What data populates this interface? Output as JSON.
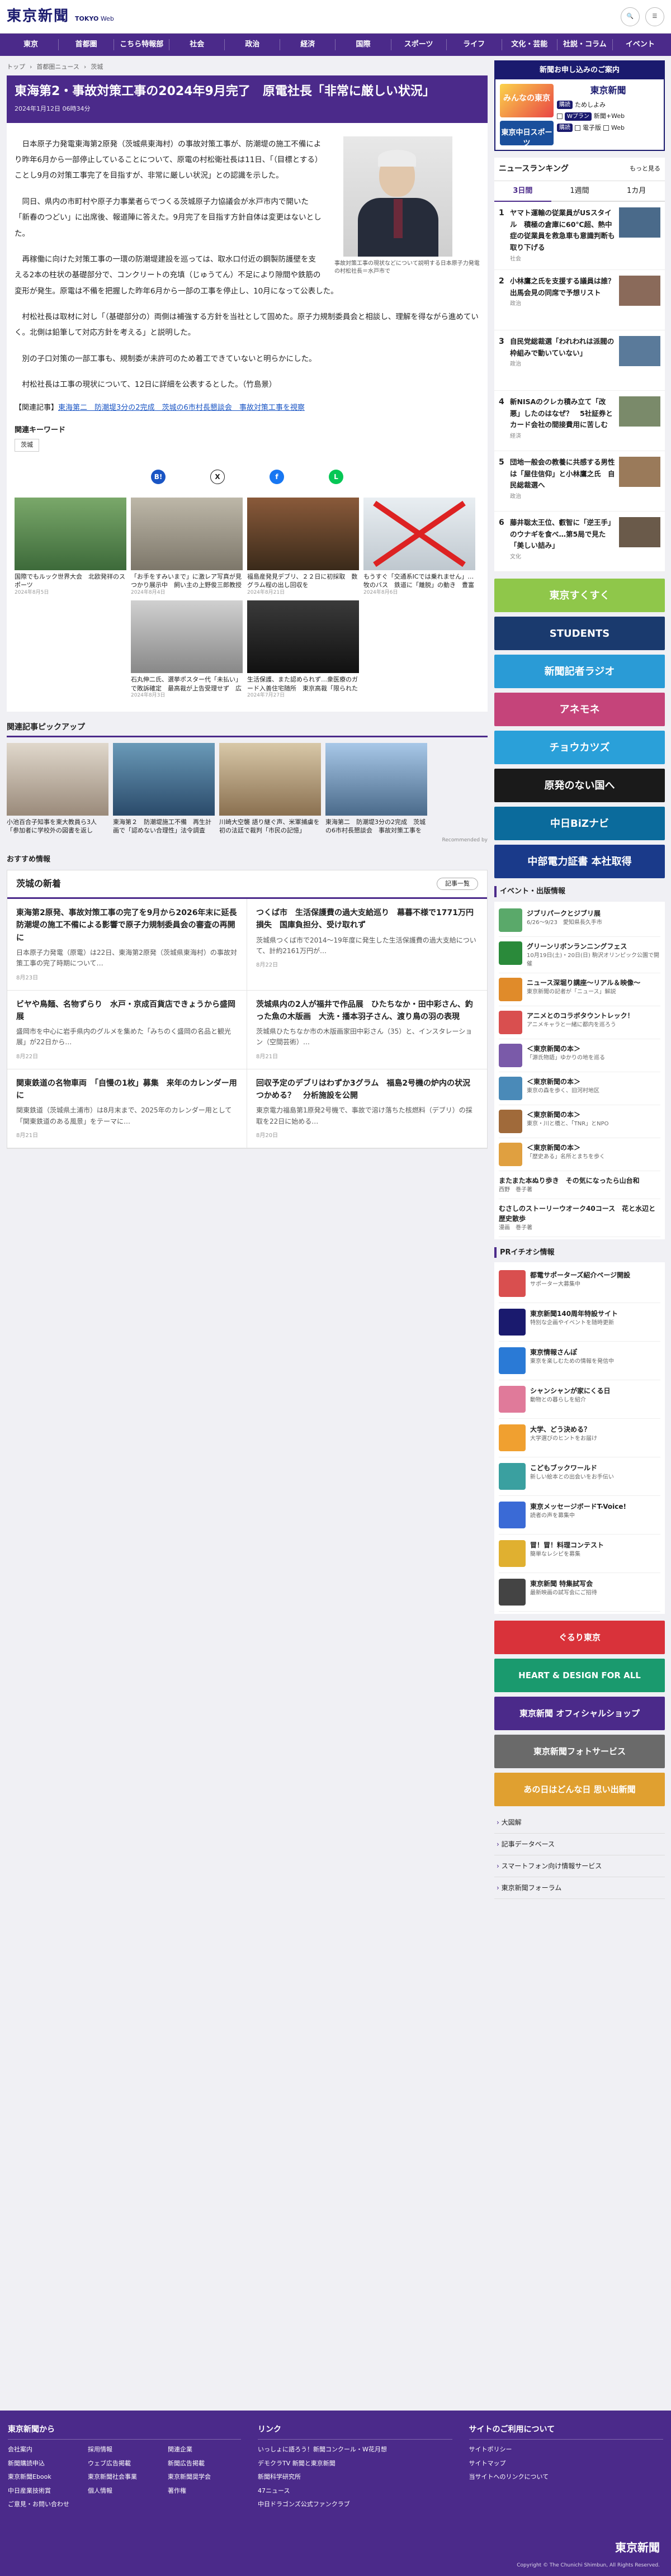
{
  "header": {
    "logo": "東京新聞",
    "edition_a": "TOKYO",
    "edition_b": "Web",
    "search": "検索",
    "menu": "メニュー"
  },
  "nav": [
    "東京",
    "首都圏",
    "こちら特報部",
    "社会",
    "政治",
    "経済",
    "国際",
    "スポーツ",
    "ライフ",
    "文化・芸能",
    "社説・コラム",
    "イベント"
  ],
  "crumb": [
    "トップ",
    "首都圏ニュース",
    "茨城"
  ],
  "article": {
    "title": "東海第2・事故対策工事の2024年9月完了　原電社長「非常に厳しい状況」",
    "date": "2024年1月12日 06時34分",
    "caption": "事故対策工事の現状などについて説明する日本原子力発電の村松社長＝水戸市で",
    "paras": [
      "日本原子力発電東海第2原発（茨城県東海村）の事故対策工事が、防潮堤の施工不備により昨年6月から一部停止していることについて、原電の村松衛社長は11日、「（目標とする）ことし9月の対策工事完了を目指すが、非常に厳しい状況」との認識を示した。",
      "同日、県内の市町村や原子力事業者らでつくる茨城原子力協議会が水戸市内で開いた「新春のつどい」に出席後、報道陣に答えた。9月完了を目指す方針自体は変更はないとした。",
      "再稼働に向けた対策工事の一環の防潮堤建設を巡っては、取水口付近の鋼製防護壁を支える2本の柱状の基礎部分で、コンクリートの充填（じゅうてん）不足により隙間や鉄筋の変形が発生。原電は不備を把握した昨年6月から一部の工事を停止し、10月になって公表した。",
      "村松社長は取材に対し「（基礎部分の）両側は補強する方針を当社として固めた。原子力規制委員会と相談し、理解を得ながら進めていく。北側は鉛筆して対応方針を考える」と説明した。",
      "別の子口対策の一部工事も、規制委が未許可のため着工できていないと明らかにした。",
      "村松社長は工事の現状について、12日に詳細を公表するとした。（竹島景）"
    ],
    "related_label": "【関連記事】",
    "related_link": "東海第二　防潮堤3分の2完成　茨城の6市村長懇談会　事故対策工事を視察"
  },
  "keywords": {
    "title": "関連キーワード",
    "tag": "茨城"
  },
  "share": [
    "B!",
    "X",
    "f",
    "L"
  ],
  "grid": [
    {
      "t": "国際でもルック世界大会　北欧発祥のスポーツ",
      "d": "2024年8月5日"
    },
    {
      "t": "「お手をすみいまで」に激レア写真が見つかり展示中　飼い主の上野俊三郎教授が寄贈してきた",
      "d": "2024年8月4日"
    },
    {
      "t": "福島産発見デブリ、２２日に初採取　数グラム程の出し回収を",
      "d": "2024年8月21日"
    },
    {
      "t": "もうすぐ「交通系ICでは乗れません」…牧のバス　鉄道に「離脱」の動き　豊富両線と…",
      "d": "2024年8月6日"
    },
    {
      "t": "",
      "d": ""
    },
    {
      "t": "石丸伸二氏、選挙ポスター代「未払い」で敗訴確定　最高裁が上告受理せず　広島・安芸…",
      "d": "2024年8月3日"
    },
    {
      "t": "生活保護、また認められず…衆医療のガード入善住宅随所　東京高裁「限られた財源で国の裁量」",
      "d": "2024年7月27日"
    }
  ],
  "pickup": {
    "title": "関連記事ピックアップ",
    "items": [
      {
        "t": "小池百合子知事を東大教員ら3人「参加者に学校外の図書を返して」…物持が「都内8人委員会」"
      },
      {
        "t": "東海第２　防潮堤施工不備　再生計画で「認めない合理性」法令調査"
      },
      {
        "t": "川崎大空襲 語り継ぐ声、米軍捕虜を初の法廷で裁判「市民の記憶」"
      },
      {
        "t": "東海第二　防潮堤3分の2完成　茨城の6市村長懇談会　事故対策工事を視察"
      }
    ],
    "rec": "Recommended by"
  },
  "osusume": "おすすめ情報",
  "ibaraki": {
    "title": "茨城の新着",
    "more": "記事一覧",
    "items": [
      {
        "t": "東海第2原発、事故対策工事の完了を9月から2026年末に延長　防潮堤の施工不備による影響で原子力規制委員会の審査の再開に",
        "d": "日本原子力発電（原電）は22日、東海第2原発（茨城県東海村）の事故対策工事の完了時期について…",
        "dt": "8月23日"
      },
      {
        "t": "つくば市　生活保護費の過大支給巡り　幕暮不様で1771万円損失　国庫負担分、受け取れず",
        "d": "茨城県つくば市で2014〜19年度に発生した生活保護費の過大支給について、計約2161万円が…",
        "dt": "8月22日"
      },
      {
        "t": "ビヤや鳥麺、名物ずらり　水戸・京成百貨店できょうから盛岡展",
        "d": "盛岡市を中心に岩手県内のグルメを集めた「みちのく盛岡の名品と観光展」が22日から…",
        "dt": "8月22日"
      },
      {
        "t": "茨城県内の2人が福井で作品展　ひたちなか・田中彩さん、釣った魚の木版画　大洗・播本羽子さん、渡り鳥の羽の表現",
        "d": "茨城県ひたちなか市の木版画家田中彩さん（35）と、インスタレーション（空間芸術）…",
        "dt": "8月21日"
      },
      {
        "t": "関東鉄道の名物車両　「自慢の1枚」募集　来年のカレンダー用に",
        "d": "関東鉄道（茨城県土浦市）は8月末まで、2025年のカレンダー用として「関東鉄道のある風景」をテーマに…",
        "dt": "8月21日"
      },
      {
        "t": "回収予定のデブリはわずか3グラム　福島2号機の炉内の状況つかめる？　分析施設を公開",
        "d": "東京電力福島第1原発2号機で、事故で溶け落ちた核燃料（デブリ）の採取を22日に始める…",
        "dt": "8月20日"
      }
    ]
  },
  "promo": {
    "head": "新聞お申し込みのご案内",
    "paper": "東京新聞",
    "r1a": "購読",
    "r1b": "ためしよみ",
    "r2a": "Wプラン",
    "r2b": "新聞+Web",
    "r3a": "購読",
    "r3b": "電子版",
    "r3c": "Web",
    "left1": "みんなの東京",
    "left2": "東京中日スポーツ"
  },
  "ranking": {
    "title": "ニュースランキング",
    "more": "もっと見る",
    "tabs": [
      "3日間",
      "1週間",
      "1カ月"
    ],
    "items": [
      {
        "n": "1",
        "t": "ヤマト運輸の従業員がUSスタイル　積極の倉庫に60℃超、熱中症の従業員を救急車も意識判断も取り下げる",
        "c": "社会"
      },
      {
        "n": "2",
        "t": "小林鷹之氏を支援する議員は誰？　出馬会見の同席で予想リスト",
        "c": "政治"
      },
      {
        "n": "3",
        "t": "自民党総裁選「われわれは派閥の枠組みで動いていない」",
        "c": "政治"
      },
      {
        "n": "4",
        "t": "新NISAのクレカ積み立て「改悪」したのはなぜ？　5社証券とカード会社の間接費用に苦しむ",
        "c": "経済"
      },
      {
        "n": "5",
        "t": "団地一般会の教養に共感する男性は「屋住信仰」と小林鷹之氏　自民総裁選へ",
        "c": "政治"
      },
      {
        "n": "6",
        "t": "藤井聡太王位、叡智に「逆王手」のウナギを食べ…第5局で見た「美しい詰み」",
        "c": "文化"
      }
    ]
  },
  "banners": [
    {
      "t": "東京すくすく",
      "c": "#8fc74a"
    },
    {
      "t": "STUDENTS",
      "c": "#1a3a6e"
    },
    {
      "t": "新聞記者ラジオ",
      "c": "#2a9bd6"
    },
    {
      "t": "アネモネ",
      "c": "#c5447a"
    },
    {
      "t": "チョウカツズ",
      "c": "#2aa0d9"
    },
    {
      "t": "原発のない国へ",
      "c": "#1a1a1a"
    },
    {
      "t": "中日BiZナビ",
      "c": "#0b6b9c"
    },
    {
      "t": "中部電力証書 本社取得",
      "c": "#1a3a8a"
    }
  ],
  "events": {
    "title": "イベント・出版情報",
    "items": [
      {
        "t": "ジブリパークとジブリ展",
        "s": "6/26〜9/23　愛知県長久手市",
        "c": "#5aa96a"
      },
      {
        "t": "グリーンリボンランニングフェス",
        "s": "10月19日(土)・20日(日) 駒沢オリンピック公園で開催",
        "c": "#2a8a3a"
      },
      {
        "t": "ニュース深堀り講座〜リアル＆映像〜",
        "s": "東京新聞の記者が「ニュース」解説",
        "c": "#e08b2a"
      },
      {
        "t": "アニメとのコラボタウントレック！",
        "s": "アニメキャラと一緒に都内を巡ろう",
        "c": "#d94f4f"
      },
      {
        "t": "＜東京新聞の本＞",
        "s": "「源氏物語」ゆかりの地を巡る",
        "c": "#7a5aa9"
      },
      {
        "t": "＜東京新聞の本＞",
        "s": "東京の森を歩く、旧河村地区",
        "c": "#4a8ab8"
      },
      {
        "t": "＜東京新聞の本＞",
        "s": "東京・川と橋と、「TNR」とNPO",
        "c": "#a06a3a"
      },
      {
        "t": "＜東京新聞の本＞",
        "s": "「歴史ある」名所とまちを歩く",
        "c": "#e0a040"
      }
    ],
    "extra": [
      {
        "t": "またまた本ぬり歩き　その気になったら山台和",
        "s": "西野　巻子著"
      },
      {
        "t": "むさしのストーリーウオーク40コース　花と水辺と歴史散歩",
        "s": "漫画　巻子著"
      }
    ]
  },
  "pr": {
    "title": "PRイチオシ情報",
    "items": [
      {
        "t": "都電サポーターズ紹介ページ開設",
        "s": "サポーター大募集中",
        "c": "#d94f4f"
      },
      {
        "t": "東京新聞140周年特設サイト",
        "s": "特別な企画やイベントを随時更新",
        "c": "#1a1a6e"
      },
      {
        "t": "東京情報さんぽ",
        "s": "東京を楽しむための情報を発信中",
        "c": "#2a7ad6"
      },
      {
        "t": "シャンシャンが家にくる日",
        "s": "動物との暮らしを紹介",
        "c": "#e07a9a"
      },
      {
        "t": "大学、どう決める？",
        "s": "大学選びのヒントをお届け",
        "c": "#f0a030"
      },
      {
        "t": "こどもブックワールド",
        "s": "新しい絵本との出会いをお手伝い",
        "c": "#3aa0a0"
      },
      {
        "t": "東京メッセージボードT-Voice!",
        "s": "読者の声を募集中",
        "c": "#3a6ad6"
      },
      {
        "t": "冒！冒！料理コンテスト",
        "s": "簡単なレシピを募集",
        "c": "#e0b030"
      },
      {
        "t": "東京新聞 特集試写会",
        "s": "最新映画の試写会にご招待",
        "c": "#444"
      }
    ]
  },
  "mini_banners": [
    {
      "t": "ぐるり東京",
      "c": "#d9323a"
    },
    {
      "t": "HEART & DESIGN FOR ALL",
      "c": "#1a9a6e"
    },
    {
      "t": "東京新聞 オフィシャルショップ",
      "c": "#4b2a8a"
    },
    {
      "t": "東京新聞フォトサービス",
      "c": "#6a6a6a"
    },
    {
      "t": "あの日はどんな日 思い出新聞",
      "c": "#e0a030"
    }
  ],
  "side_links": [
    "大図解",
    "記事データベース",
    "スマートフォン向け情報サービス",
    "東京新聞フォーラム"
  ],
  "footer": {
    "col1_title": "東京新聞から",
    "col1": [
      "会社案内",
      "採用情報",
      "関連企業",
      "新聞購読申込",
      "ウェブ広告掲載",
      "新聞広告掲載",
      "東京新聞Ebook",
      "東京新聞社会事業",
      "東京新聞奨学会",
      "中日産業技術賞",
      "個人情報",
      "著作権",
      "ご意見・お問い合わせ"
    ],
    "col2_title": "リンク",
    "col2": [
      "いっしょに語ろう！新聞コンクール・W花月想",
      "デモクラTV 新聞と東京新聞",
      "新聞科学研究所",
      "47ニュース",
      "中日ドラゴンズ公式ファンクラブ"
    ],
    "col3_title": "サイトのご利用について",
    "col3": [
      "サイトポリシー",
      "サイトマップ",
      "当サイトへのリンクについて"
    ],
    "logo": "東京新聞",
    "copy": "Copyright © The Chunichi Shimbun, All Rights Reserved."
  },
  "colors": {
    "brand": "#4b2a8a",
    "navy": "#1a1a6e"
  }
}
